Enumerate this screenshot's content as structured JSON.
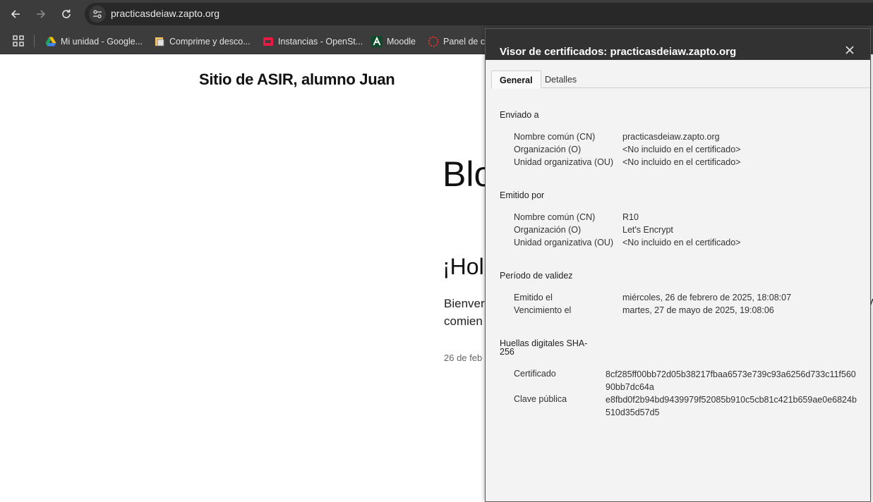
{
  "browser": {
    "url": "practicasdeiaw.zapto.org",
    "bookmarks": [
      {
        "label": "Mi unidad - Google...",
        "icon": "google-drive-icon"
      },
      {
        "label": "Comprime y desco...",
        "icon": "folder-icon"
      },
      {
        "label": "Instancias - OpenSt...",
        "icon": "openstack-icon"
      },
      {
        "label": "Moodle",
        "icon": "moodle-icon"
      },
      {
        "label": "Panel de co",
        "icon": "panel-icon"
      }
    ]
  },
  "page": {
    "site_title": "Sitio de ASIR, alumno Juan",
    "blog_heading": "Blo",
    "post_title": "¡Hol",
    "excerpt_line1": "Bienver",
    "excerpt_line2": "comien",
    "excerpt_right_fragment": "y",
    "post_date": "26 de feb"
  },
  "dialog": {
    "title": "Visor de certificados: practicasdeiaw.zapto.org",
    "tabs": [
      "General",
      "Detalles"
    ],
    "issued_to": {
      "heading": "Enviado a",
      "rows": [
        {
          "label": "Nombre común (CN)",
          "value": "practicasdeiaw.zapto.org"
        },
        {
          "label": "Organización (O)",
          "value": "<No incluido en el certificado>"
        },
        {
          "label": "Unidad organizativa (OU)",
          "value": "<No incluido en el certificado>"
        }
      ]
    },
    "issued_by": {
      "heading": "Emitido por",
      "rows": [
        {
          "label": "Nombre común (CN)",
          "value": "R10"
        },
        {
          "label": "Organización (O)",
          "value": "Let's Encrypt"
        },
        {
          "label": "Unidad organizativa (OU)",
          "value": "<No incluido en el certificado>"
        }
      ]
    },
    "validity": {
      "heading": "Período de validez",
      "rows": [
        {
          "label": "Emitido el",
          "value": "miércoles, 26 de febrero de 2025, 18:08:07"
        },
        {
          "label": "Vencimiento el",
          "value": "martes, 27 de mayo de 2025, 19:08:06"
        }
      ]
    },
    "fingerprints": {
      "heading_line1": "Huellas digitales SHA-",
      "heading_line2": "256",
      "rows": [
        {
          "label": "Certificado",
          "value": "8cf285ff00bb72d05b38217fbaa6573e739c93a6256d733c11f56090bb7dc64a"
        },
        {
          "label": "Clave pública",
          "value": "e8fbd0f2b94bd9439979f52085b910c5cb81c421b659ae0e6824b510d35d57d5"
        }
      ]
    }
  }
}
